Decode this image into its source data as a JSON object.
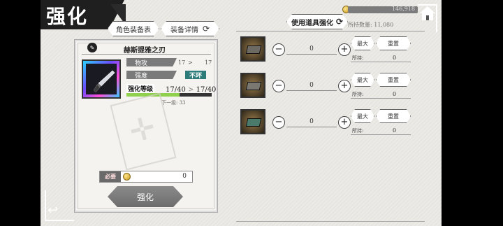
{
  "screen_title": "强化",
  "tabs": [
    {
      "label": "角色装备表"
    },
    {
      "label": "装备详情"
    }
  ],
  "item": {
    "name": "赫斯提雅之刃",
    "stats": [
      {
        "label": "物攻",
        "current": "17",
        "arrow": ">",
        "next": "17"
      },
      {
        "label": "强度",
        "badge": "不坏"
      }
    ],
    "level_label": "强化等级",
    "level_current": "17/40",
    "level_arrow": ">",
    "level_next": "17/40",
    "level_progress": 0.62,
    "next_text": "下一级: 33"
  },
  "required": {
    "label": "必要",
    "value": "0"
  },
  "enhance_button": "强化",
  "use_items_button": "使用道具强化",
  "currency": {
    "total": "146,918",
    "owned_text": "所持数量: 11,080"
  },
  "materials": [
    {
      "qty": "0",
      "max_label": "最大",
      "reset_label": "重置",
      "owned_label": "所持:",
      "owned": "0",
      "color": "#6d6a64"
    },
    {
      "qty": "0",
      "max_label": "最大",
      "reset_label": "重置",
      "owned_label": "所持:",
      "owned": "0",
      "color": "#7a7870"
    },
    {
      "qty": "0",
      "max_label": "最大",
      "reset_label": "重置",
      "owned_label": "所持:",
      "owned": "0",
      "color": "#4a7a6a"
    }
  ],
  "icons": [
    "refresh-icon",
    "home-icon",
    "back-icon",
    "coin-icon",
    "minus-icon",
    "plus-icon",
    "dagger-icon"
  ]
}
